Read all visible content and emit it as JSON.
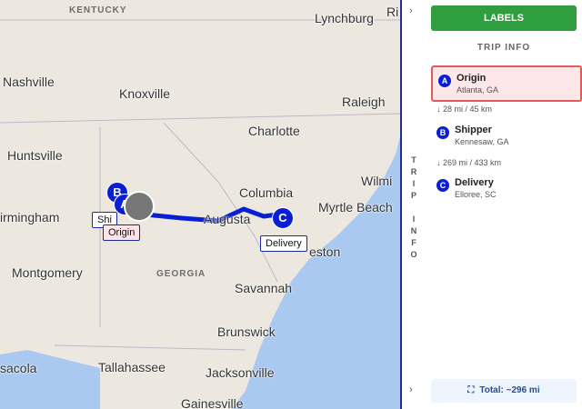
{
  "map": {
    "states": [
      "KENTUCKY",
      "GEORGIA"
    ],
    "cities": [
      "Lynchburg",
      "Ri",
      "Nashville",
      "Knoxville",
      "Raleigh",
      "Charlotte",
      "Huntsville",
      "Columbia",
      "Wilmi",
      "Myrtle Beach",
      "irmingham",
      "Augusta",
      "Montgomery",
      "Savannah",
      "Brunswick",
      "sacola",
      "Tallahassee",
      "Jacksonville",
      "Gainesville",
      "eston"
    ],
    "markers": {
      "origin": "A",
      "shipper": "B",
      "delivery": "C"
    },
    "pin_labels": {
      "shipper_partial": "Shi",
      "origin": "Origin",
      "delivery": "Delivery"
    }
  },
  "rail": {
    "vertical_text": "TRIP INFO",
    "top_icon": "chevron-right-icon",
    "bottom_icon": "chevron-right-icon"
  },
  "panel": {
    "labels_button": "LABELS",
    "trip_header": "TRIP INFO",
    "stops": [
      {
        "badge": "A",
        "name": "Origin",
        "location": "Atlanta, GA",
        "selected": true
      },
      {
        "badge": "B",
        "name": "Shipper",
        "location": "Kennesaw, GA",
        "selected": false
      },
      {
        "badge": "C",
        "name": "Delivery",
        "location": "Elloree, SC",
        "selected": false
      }
    ],
    "distances": [
      "↓ 28 mi / 45 km",
      "↓ 269 mi / 433 km"
    ],
    "total": "Total: ~296 mi"
  },
  "colors": {
    "route": "#0a1fd4",
    "accent_green": "#2e9e3f",
    "selected_border": "#e35a5a"
  }
}
